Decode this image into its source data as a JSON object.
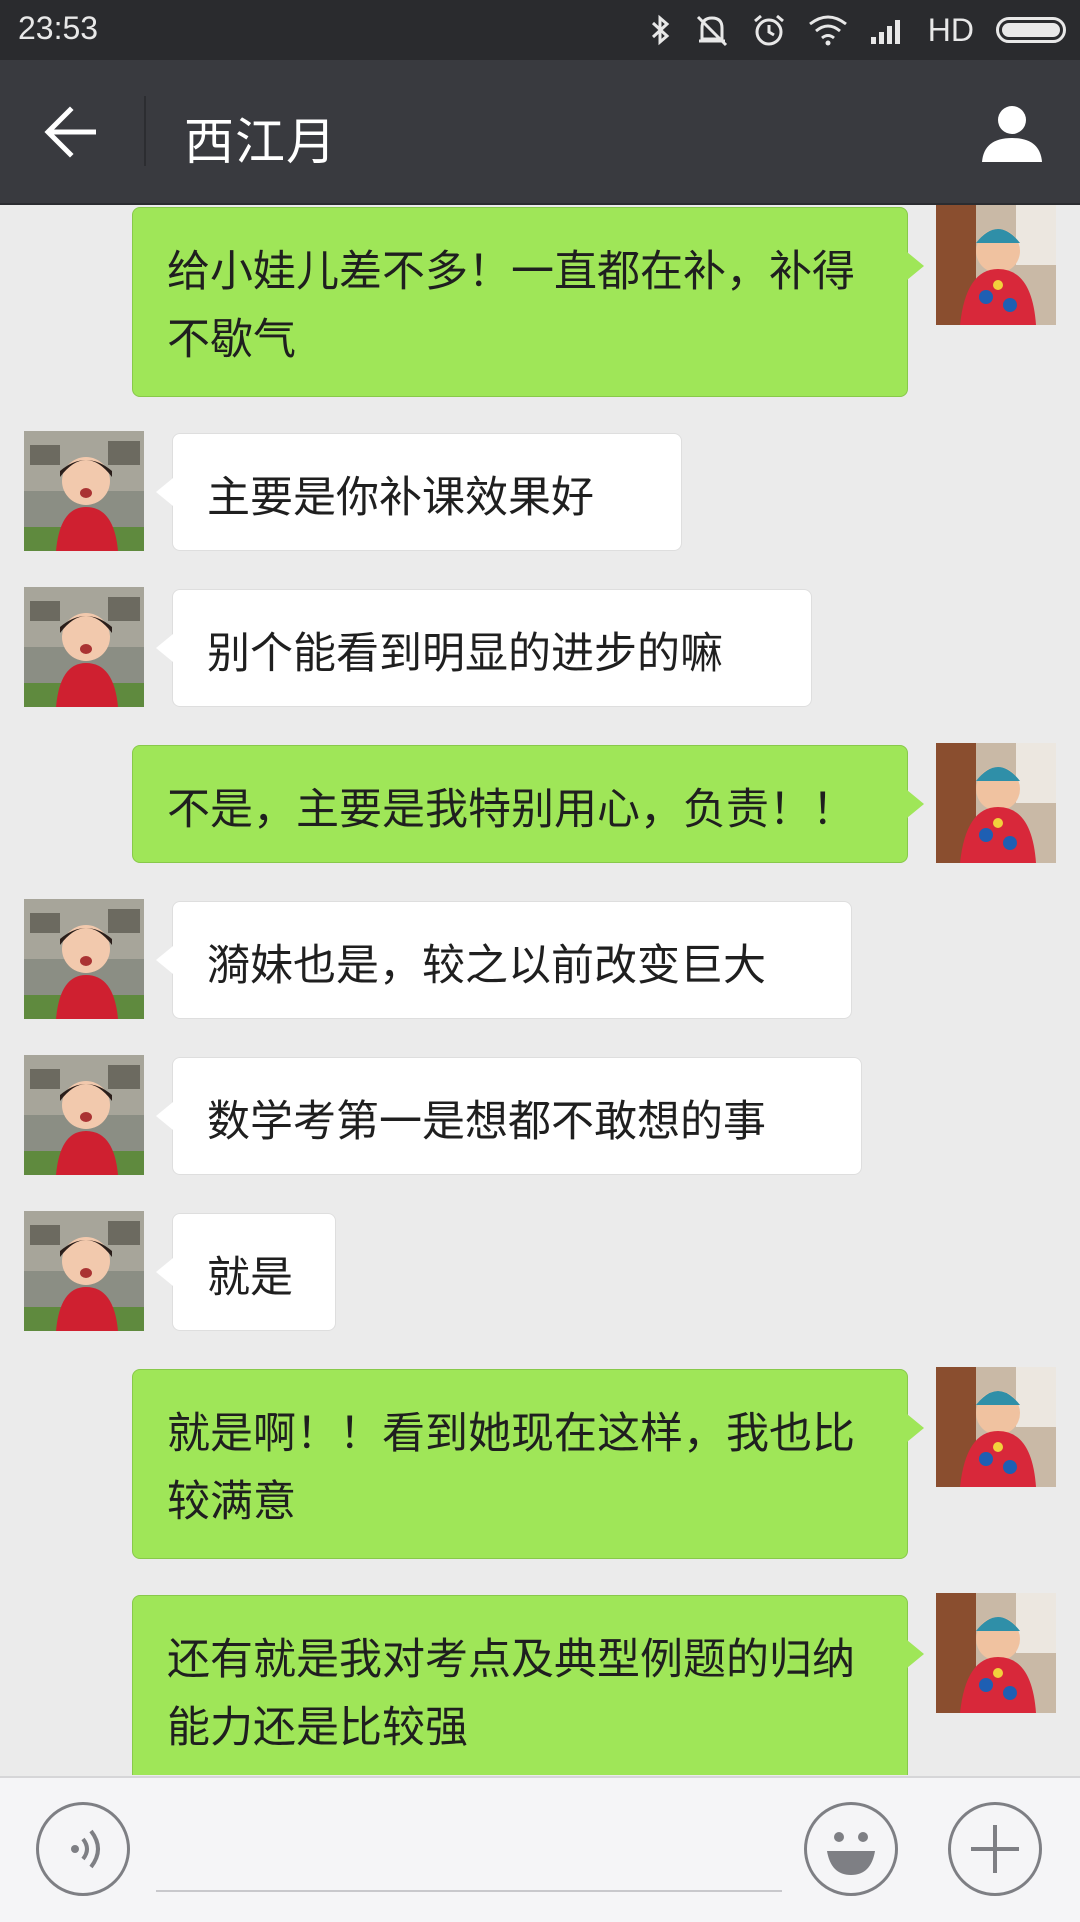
{
  "status_bar": {
    "time": "23:53",
    "network_label": "HD",
    "icons": [
      "bluetooth-icon",
      "silent-mode-icon",
      "alarm-icon",
      "wifi-icon",
      "signal-icon",
      "battery-icon"
    ]
  },
  "header": {
    "title": "西江月",
    "back_icon": "back-arrow-icon",
    "profile_icon": "profile-icon"
  },
  "messages": [
    {
      "sender": "me",
      "text": "给小娃儿差不多！一直都在补，补得不歇气"
    },
    {
      "sender": "them",
      "text": "主要是你补课效果好"
    },
    {
      "sender": "them",
      "text": "别个能看到明显的进步的嘛"
    },
    {
      "sender": "me",
      "text": "不是，主要是我特别用心，负责！！"
    },
    {
      "sender": "them",
      "text": "漪妹也是，较之以前改变巨大"
    },
    {
      "sender": "them",
      "text": "数学考第一是想都不敢想的事"
    },
    {
      "sender": "them",
      "text": "就是"
    },
    {
      "sender": "me",
      "text": "就是啊！！看到她现在这样，我也比较满意"
    },
    {
      "sender": "me",
      "text": "还有就是我对考点及典型例题的归纳能力还是比较强"
    }
  ],
  "input_bar": {
    "placeholder": "",
    "voice_icon": "voice-input-icon",
    "emoji_icon": "emoji-icon",
    "plus_icon": "plus-icon"
  },
  "colors": {
    "header_bg": "#393a3f",
    "status_bg": "#2a2b2e",
    "chat_bg": "#ebebeb",
    "my_bubble": "#9fe658",
    "their_bubble": "#ffffff"
  }
}
